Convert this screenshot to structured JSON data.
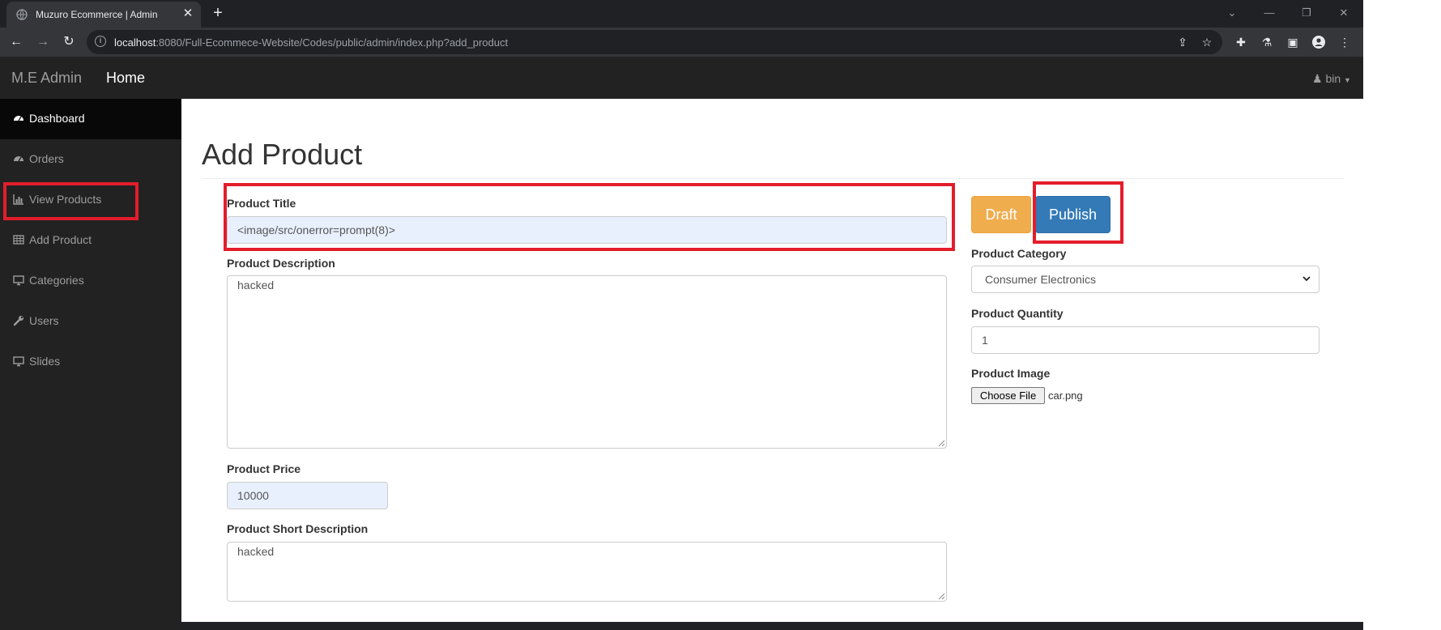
{
  "browser": {
    "tab_title": "Muzuro Ecommerce | Admin",
    "url_host": "localhost",
    "url_rest": ":8080/Full-Ecommece-Website/Codes/public/admin/index.php?add_product"
  },
  "navbar": {
    "brand": "M.E Admin",
    "home": "Home",
    "user": "bin"
  },
  "sidebar": {
    "items": [
      {
        "label": "Dashboard",
        "icon": "dashboard-icon"
      },
      {
        "label": "Orders",
        "icon": "dashboard-icon"
      },
      {
        "label": "View Products",
        "icon": "bar-chart-icon"
      },
      {
        "label": "Add Product",
        "icon": "table-icon"
      },
      {
        "label": "Categories",
        "icon": "desktop-icon"
      },
      {
        "label": "Users",
        "icon": "wrench-icon"
      },
      {
        "label": "Slides",
        "icon": "desktop-icon"
      }
    ]
  },
  "page": {
    "title": "Add Product"
  },
  "form": {
    "title_label": "Product Title",
    "title_value": "<image/src/onerror=prompt(8)>",
    "description_label": "Product Description",
    "description_value": "hacked",
    "price_label": "Product Price",
    "price_value": "10000",
    "short_desc_label": "Product Short Description",
    "short_desc_value": "hacked",
    "draft_label": "Draft",
    "publish_label": "Publish",
    "category_label": "Product Category",
    "category_value": "Consumer Electronics",
    "quantity_label": "Product Quantity",
    "quantity_value": "1",
    "image_label": "Product Image",
    "choose_file_label": "Choose File",
    "file_name": "car.png"
  },
  "colors": {
    "highlight": "#e31d2b",
    "draft": "#f0ad4e",
    "publish": "#337ab7"
  }
}
